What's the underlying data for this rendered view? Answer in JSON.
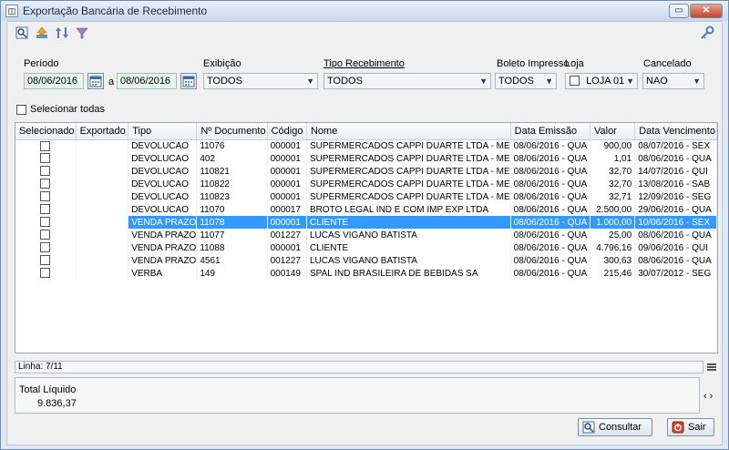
{
  "window": {
    "title": "Exportação Bancária de Recebimento"
  },
  "filters": {
    "periodo_label": "Período",
    "periodo_start": "08/06/2016",
    "periodo_sep": "a",
    "periodo_end": "08/06/2016",
    "exibicao_label": "Exibição",
    "exibicao_value": "TODOS",
    "tipo_recebimento_label": "Tipo Recebimento",
    "tipo_recebimento_value": "TODOS",
    "boleto_impresso_label": "Boleto Impresso",
    "boleto_impresso_value": "TODOS",
    "loja_label": "Loja",
    "loja_value": "LOJA 01",
    "cancelado_label": "Cancelado",
    "cancelado_value": "NAO"
  },
  "select_all_label": "Selecionar todas",
  "table": {
    "columns": [
      "Selecionado",
      "Exportado",
      "Tipo",
      "Nº Documento",
      "Código",
      "Nome",
      "Data Emissão",
      "Valor",
      "Data Vencimento"
    ],
    "rows": [
      {
        "tipo": "DEVOLUCAO",
        "doc": "11076",
        "codigo": "000001",
        "nome": "SUPERMERCADOS CAPPI DUARTE LTDA - ME",
        "emissao": "08/06/2016 - QUA",
        "valor": "900,00",
        "vencimento": "08/07/2016 - SEX"
      },
      {
        "tipo": "DEVOLUCAO",
        "doc": "402",
        "codigo": "000001",
        "nome": "SUPERMERCADOS CAPPI DUARTE LTDA - ME",
        "emissao": "08/06/2016 - QUA",
        "valor": "1,01",
        "vencimento": "08/06/2016 - QUA"
      },
      {
        "tipo": "DEVOLUCAO",
        "doc": "110821",
        "codigo": "000001",
        "nome": "SUPERMERCADOS CAPPI DUARTE LTDA - ME",
        "emissao": "08/06/2016 - QUA",
        "valor": "32,70",
        "vencimento": "14/07/2016 - QUI"
      },
      {
        "tipo": "DEVOLUCAO",
        "doc": "110822",
        "codigo": "000001",
        "nome": "SUPERMERCADOS CAPPI DUARTE LTDA - ME",
        "emissao": "08/06/2016 - QUA",
        "valor": "32,70",
        "vencimento": "13/08/2016 - SAB"
      },
      {
        "tipo": "DEVOLUCAO",
        "doc": "110823",
        "codigo": "000001",
        "nome": "SUPERMERCADOS CAPPI DUARTE LTDA - ME",
        "emissao": "08/06/2016 - QUA",
        "valor": "32,71",
        "vencimento": "12/09/2016 - SEG"
      },
      {
        "tipo": "DEVOLUCAO",
        "doc": "11070",
        "codigo": "000017",
        "nome": "BROTO LEGAL IND E COM IMP EXP LTDA",
        "emissao": "08/06/2016 - QUA",
        "valor": "2.500,00",
        "vencimento": "29/06/2016 - QUA"
      },
      {
        "tipo": "VENDA PRAZO",
        "doc": "11078",
        "codigo": "000001",
        "nome": "CLIENTE",
        "emissao": "08/06/2016 - QUA",
        "valor": "1.000,00",
        "vencimento": "10/06/2016 - SEX"
      },
      {
        "tipo": "VENDA PRAZO",
        "doc": "11077",
        "codigo": "001227",
        "nome": "LUCAS VIGANO BATISTA",
        "emissao": "08/06/2016 - QUA",
        "valor": "25,00",
        "vencimento": "08/06/2016 - QUA"
      },
      {
        "tipo": "VENDA PRAZO",
        "doc": "11088",
        "codigo": "000001",
        "nome": "CLIENTE",
        "emissao": "08/06/2016 - QUA",
        "valor": "4.796,16",
        "vencimento": "09/06/2016 - QUI"
      },
      {
        "tipo": "VENDA PRAZO",
        "doc": "4561",
        "codigo": "001227",
        "nome": "LUCAS VIGANO BATISTA",
        "emissao": "08/06/2016 - QUA",
        "valor": "300,63",
        "vencimento": "08/06/2016 - QUA"
      },
      {
        "tipo": "VERBA",
        "doc": "149",
        "codigo": "000149",
        "nome": "SPAL IND BRASILEIRA DE BEBIDAS SA",
        "emissao": "08/06/2016 - QUA",
        "valor": "215,46",
        "vencimento": "30/07/2012 - SEG"
      }
    ],
    "selected_row_index": 6
  },
  "status": {
    "linha": "Linha: 7/11"
  },
  "totals": {
    "label": "Total Líquido",
    "value": "9.836,37"
  },
  "buttons": {
    "consultar": "Consultar",
    "sair": "Sair"
  },
  "colors": {
    "selection": "#3399ff",
    "date_field": "#e8f6e8"
  }
}
